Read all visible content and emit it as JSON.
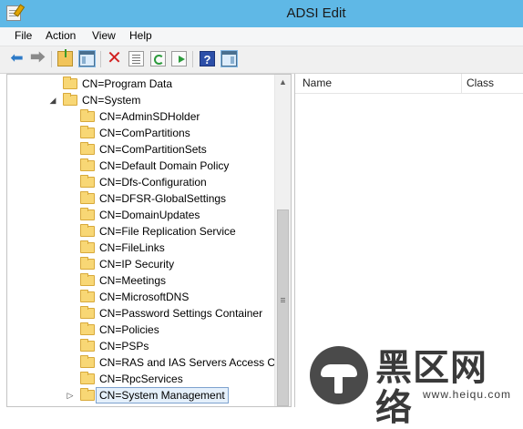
{
  "window": {
    "title": "ADSI Edit"
  },
  "menu": [
    "File",
    "Action",
    "View",
    "Help"
  ],
  "toolbar": {
    "buttons": [
      "back-icon",
      "forward-icon",
      "up-folder-icon",
      "show-hide-tree-icon",
      "delete-icon",
      "properties-icon",
      "refresh-icon",
      "export-list-icon",
      "help-icon",
      "show-hide-action-pane-icon"
    ],
    "colors": {
      "titlebar": "#5fb8e6",
      "delete": "#d22020",
      "help": "#2d4fa8"
    }
  },
  "tree": {
    "items": [
      {
        "label": "CN=Program Data",
        "level": 1,
        "expander": ""
      },
      {
        "label": "CN=System",
        "level": 1,
        "expander": "expanded"
      },
      {
        "label": "CN=AdminSDHolder",
        "level": 2,
        "expander": ""
      },
      {
        "label": "CN=ComPartitions",
        "level": 2,
        "expander": ""
      },
      {
        "label": "CN=ComPartitionSets",
        "level": 2,
        "expander": ""
      },
      {
        "label": "CN=Default Domain Policy",
        "level": 2,
        "expander": ""
      },
      {
        "label": "CN=Dfs-Configuration",
        "level": 2,
        "expander": ""
      },
      {
        "label": "CN=DFSR-GlobalSettings",
        "level": 2,
        "expander": ""
      },
      {
        "label": "CN=DomainUpdates",
        "level": 2,
        "expander": ""
      },
      {
        "label": "CN=File Replication Service",
        "level": 2,
        "expander": ""
      },
      {
        "label": "CN=FileLinks",
        "level": 2,
        "expander": ""
      },
      {
        "label": "CN=IP Security",
        "level": 2,
        "expander": ""
      },
      {
        "label": "CN=Meetings",
        "level": 2,
        "expander": ""
      },
      {
        "label": "CN=MicrosoftDNS",
        "level": 2,
        "expander": ""
      },
      {
        "label": "CN=Password Settings Container",
        "level": 2,
        "expander": ""
      },
      {
        "label": "CN=Policies",
        "level": 2,
        "expander": ""
      },
      {
        "label": "CN=PSPs",
        "level": 2,
        "expander": ""
      },
      {
        "label": "CN=RAS and IAS Servers Access Che",
        "level": 2,
        "expander": ""
      },
      {
        "label": "CN=RpcServices",
        "level": 2,
        "expander": ""
      },
      {
        "label": "CN=System Management",
        "level": 2,
        "expander": "collapsed",
        "selected": true
      }
    ]
  },
  "list": {
    "columns": [
      "Name",
      "Class"
    ]
  },
  "watermark": {
    "text": "黑区网络",
    "url": "www.heiqu.com"
  }
}
